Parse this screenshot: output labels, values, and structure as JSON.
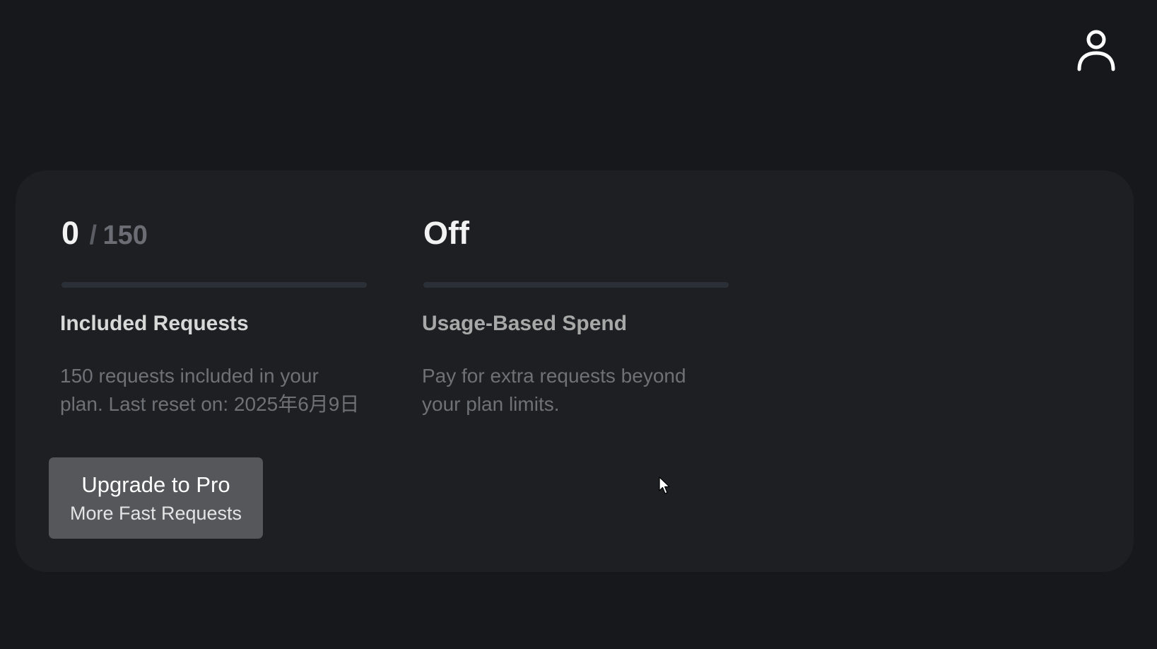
{
  "header": {
    "user_icon": "user-icon"
  },
  "usage": {
    "included": {
      "used": "0",
      "separator": "/",
      "limit": "150",
      "progress": 0,
      "title": "Included Requests",
      "description": "150 requests included in your plan. Last reset on: 2025年6月9日"
    },
    "spend": {
      "value": "Off",
      "progress": 0,
      "title": "Usage-Based Spend",
      "description": "Pay for extra requests beyond your plan limits."
    }
  },
  "upgrade": {
    "title": "Upgrade to Pro",
    "subtitle": "More Fast Requests"
  },
  "colors": {
    "background": "#16181c",
    "card": "#1d1f23",
    "track": "#2b3038",
    "button": "#55575b"
  }
}
